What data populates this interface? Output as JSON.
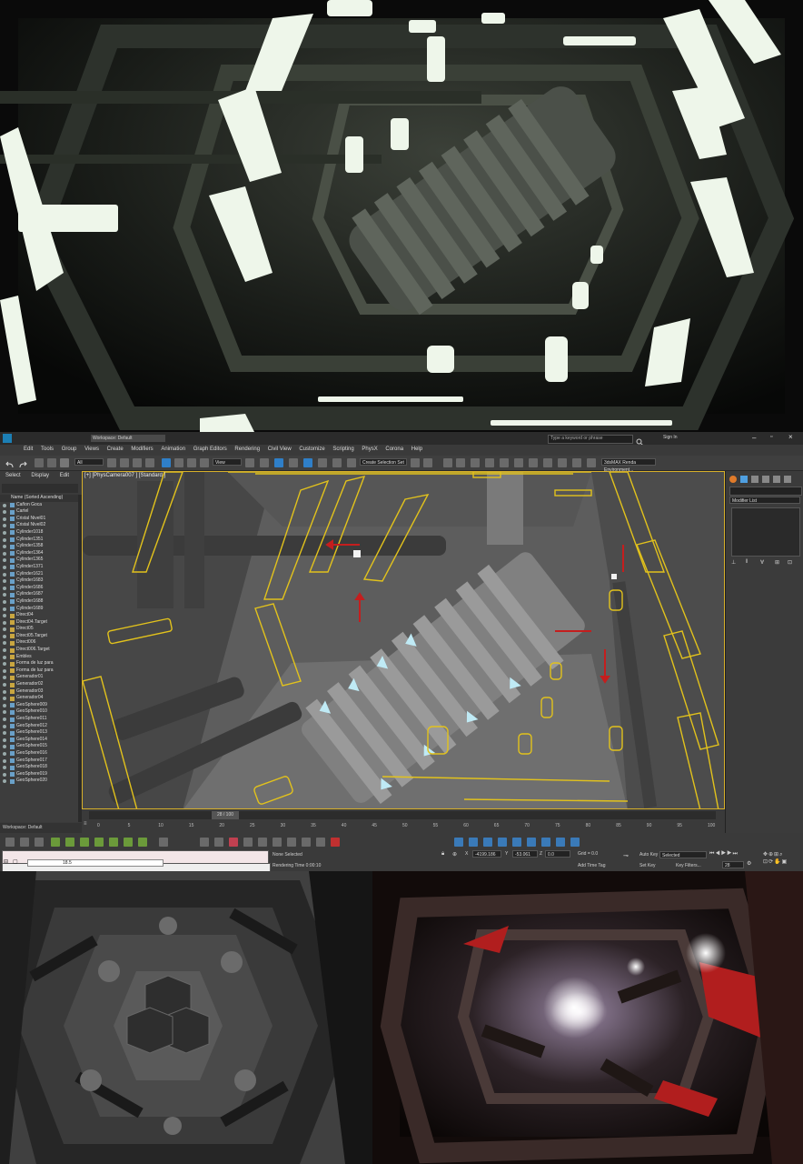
{
  "titlebar": {
    "workspace_tab": "Workspace: Default",
    "search_placeholder": "Type a keyword or phrase",
    "signin": "Sign In"
  },
  "menu": [
    "Edit",
    "Tools",
    "Group",
    "Views",
    "Create",
    "Modifiers",
    "Animation",
    "Graph Editors",
    "Rendering",
    "Civil View",
    "Customize",
    "Scripting",
    "PhysX",
    "Corona",
    "Help"
  ],
  "toolbar": {
    "selection_filter": "All",
    "ref_coord": "View",
    "named_selection": "Create Selection Set",
    "env_label": "3dsMAX Renda Environment..."
  },
  "scene_explorer": {
    "tabs": [
      "Select",
      "Display",
      "Edit"
    ],
    "header": "Name (Sorted Ascending)",
    "items": [
      "Cañon Goca",
      "Cartel",
      "Cristal Nivel01",
      "Cristal Nivel02",
      "Cylinder1018",
      "Cylinder1351",
      "Cylinder1358",
      "Cylinder1364",
      "Cylinder1365",
      "Cylinder1371",
      "Cylinder1621",
      "Cylinder1683",
      "Cylinder1686",
      "Cylinder1687",
      "Cylinder1688",
      "Cylinder1689",
      "Direct04",
      "Direct04.Target",
      "Direct05",
      "Direct05.Target",
      "Direct006",
      "Direct006.Target",
      "Embles",
      "Forma de luz para",
      "Forma de luz para",
      "Generador01",
      "Generador02",
      "Generador03",
      "Generador04",
      "GeoSphere009",
      "GeoSphere010",
      "GeoSphere011",
      "GeoSphere012",
      "GeoSphere013",
      "GeoSphere014",
      "GeoSphere015",
      "GeoSphere016",
      "GeoSphere017",
      "GeoSphere018",
      "GeoSphere019",
      "GeoSphere020"
    ],
    "workspace_footer": "Workspace: Default"
  },
  "viewport": {
    "label": "[+] [PhysCamera007 ] [Standard ]"
  },
  "timeline": {
    "frame_label": "28 / 100",
    "ticks": [
      "0",
      "5",
      "10",
      "15",
      "20",
      "25",
      "30",
      "35",
      "40",
      "45",
      "50",
      "55",
      "60",
      "65",
      "70",
      "75",
      "80",
      "85",
      "90",
      "95",
      "100"
    ]
  },
  "right_panel": {
    "modifier_list": "Modifier List"
  },
  "status": {
    "maxscript_value": "18.5",
    "none_selected": "None Selected",
    "rendering_time": "Rendering Time 0:00:10",
    "x_val": "-4199.186",
    "y_val": "-53.061",
    "z_val": "0.0",
    "grid": "Grid = 0.0",
    "add_time_tag": "Add Time Tag",
    "auto_key": "Auto Key",
    "set_key": "Set Key",
    "selected": "Selected",
    "key_filters": "Key Filters...",
    "frame_field": "28"
  },
  "colors": {
    "wire_yellow": "#e2c21c",
    "ui_dark": "#3a3a3a",
    "accent_red": "#c41e1e"
  }
}
